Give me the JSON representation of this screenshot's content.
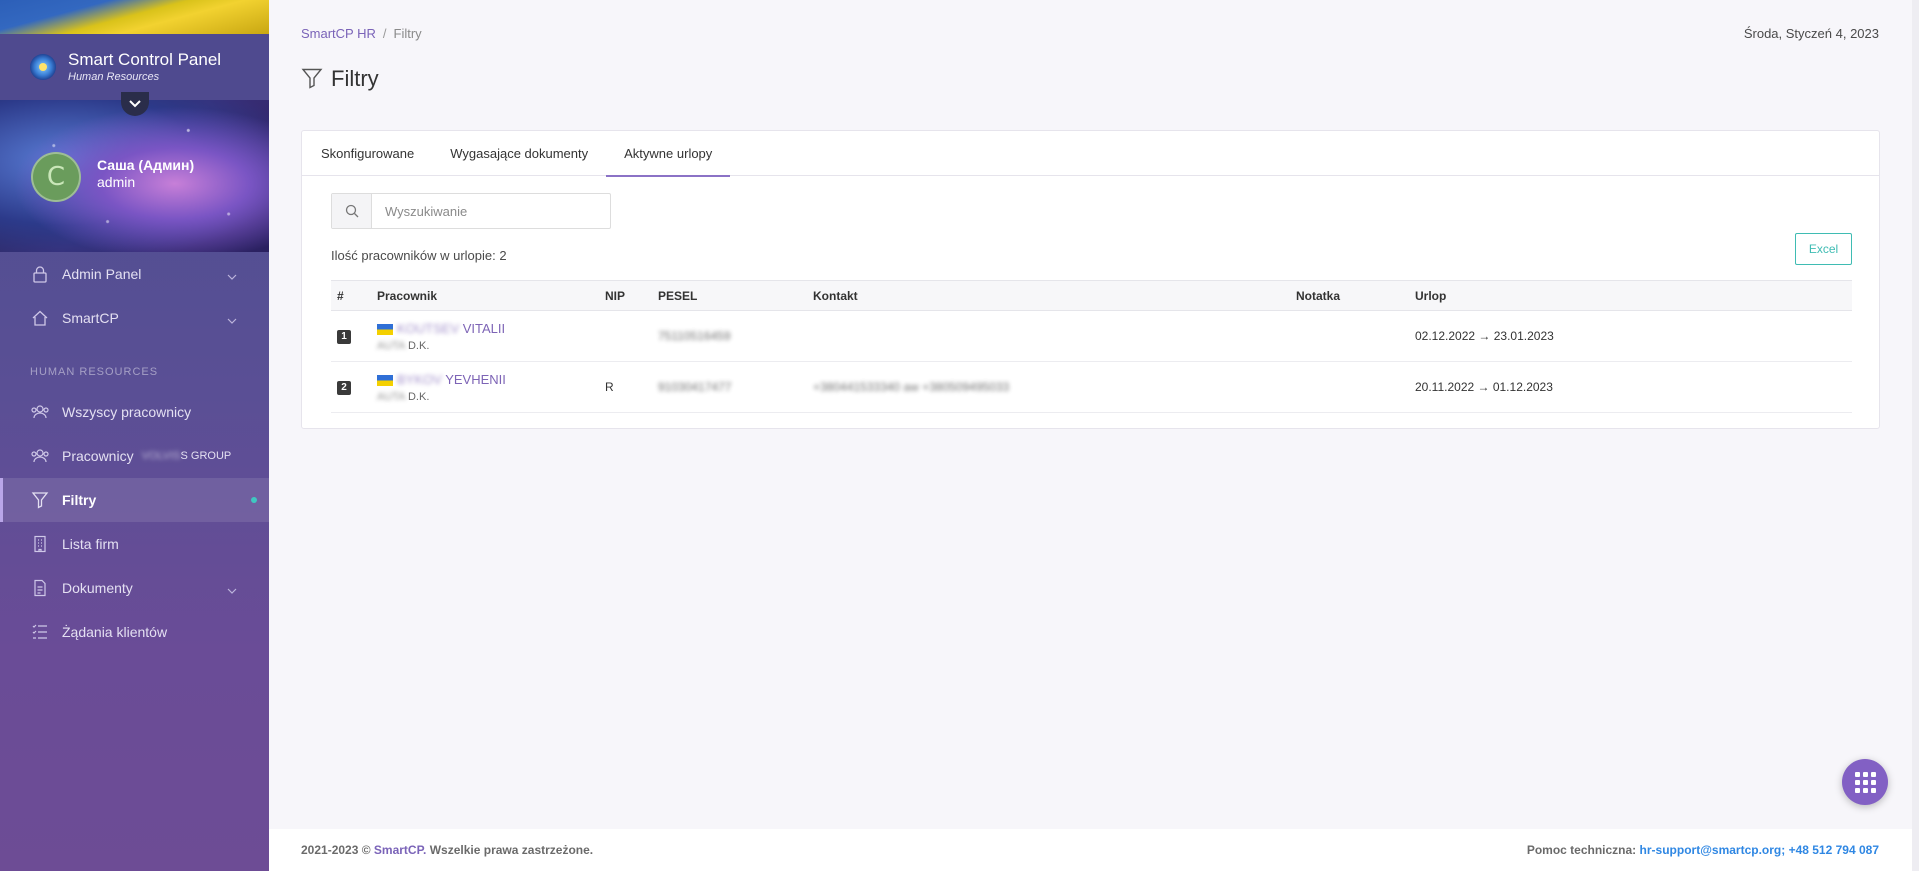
{
  "sidebar": {
    "brand_title": "Smart Control Panel",
    "brand_subtitle": "Human Resources",
    "user": {
      "initial": "C",
      "name": "Саша (Админ)",
      "role": "admin"
    },
    "menu_top": [
      {
        "label": "Admin Panel",
        "icon": "lock-icon",
        "has_chevron": true
      },
      {
        "label": "SmartCP",
        "icon": "home-icon",
        "has_chevron": true
      }
    ],
    "section_label": "HUMAN RESOURCES",
    "menu_hr": [
      {
        "label": "Wszyscy pracownicy",
        "icon": "users-icon"
      },
      {
        "label": "Pracownicy",
        "suffix_blurred": "VOLVIS",
        "suffix": "S GROUP",
        "icon": "users-icon"
      },
      {
        "label": "Filtry",
        "icon": "filter-icon",
        "active": true
      },
      {
        "label": "Lista firm",
        "icon": "building-icon"
      },
      {
        "label": "Dokumenty",
        "icon": "document-icon",
        "has_chevron": true
      },
      {
        "label": "Żądania klientów",
        "icon": "list-icon"
      }
    ]
  },
  "header": {
    "breadcrumb": {
      "root": "SmartCP HR",
      "separator": "/",
      "current": "Filtry"
    },
    "date": "Środa, Styczeń 4, 2023",
    "title": "Filtry"
  },
  "tabs": [
    {
      "label": "Skonfigurowane",
      "active": false
    },
    {
      "label": "Wygasające dokumenty",
      "active": false
    },
    {
      "label": "Aktywne urlopy",
      "active": true
    }
  ],
  "search": {
    "placeholder": "Wyszukiwanie",
    "value": ""
  },
  "count_text": "Ilość pracowników w urlopie: 2",
  "excel_label": "Excel",
  "table": {
    "columns": [
      "#",
      "Pracownik",
      "NIP",
      "PESEL",
      "Kontakt",
      "Notatka",
      "Urlop"
    ],
    "rows": [
      {
        "num": "1",
        "surname_blurred": "KOUTSEV",
        "name": "VITALII",
        "sub_blurred": "AUTA",
        "sub": "D.K.",
        "nip": "",
        "pesel_blurred": "75110516459",
        "contact_blurred": "",
        "note": "",
        "leave": "02.12.2022 → 23.01.2023"
      },
      {
        "num": "2",
        "surname_blurred": "BYKOV",
        "name": "YEVHENII",
        "sub_blurred": "AUTA",
        "sub": "D.K.",
        "nip": "R",
        "pesel_blurred": "91030417477",
        "contact_blurred": "+380441533340 aw +380509495033",
        "note": "",
        "leave": "20.11.2022 → 01.12.2023"
      }
    ]
  },
  "footer": {
    "copyright_prefix": "2021-2023 ©",
    "brand": "SmartCP.",
    "rights": "Wszelkie prawa zastrzeżone.",
    "support_label": "Pomoc techniczna:",
    "support_contact": "hr-support@smartcp.org; +48 512 794 087"
  },
  "colors": {
    "accent": "#8260c4",
    "link": "#7d64b6",
    "excel": "#3fbcb3",
    "support_link": "#2f87e3"
  }
}
